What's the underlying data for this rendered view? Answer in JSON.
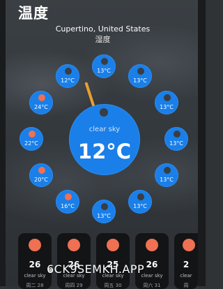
{
  "app": {
    "title": "温度",
    "location": "Cupertino, United States",
    "subtitle": "湿度"
  },
  "current": {
    "condition": "clear sky",
    "temperature": "12°C"
  },
  "hourly": [
    {
      "temp": "13°C",
      "icon": "moon-icon"
    },
    {
      "temp": "13°C",
      "icon": "moon-icon"
    },
    {
      "temp": "13°C",
      "icon": "moon-icon"
    },
    {
      "temp": "13°C",
      "icon": "moon-icon"
    },
    {
      "temp": "13°C",
      "icon": "moon-icon"
    },
    {
      "temp": "13°C",
      "icon": "moon-icon"
    },
    {
      "temp": "13°C",
      "icon": "moon-icon"
    },
    {
      "temp": "13°C",
      "icon": "moon-icon"
    },
    {
      "temp": "16°C",
      "icon": "sun-icon"
    },
    {
      "temp": "20°C",
      "icon": "sun-icon"
    },
    {
      "temp": "22°C",
      "icon": "sun-icon"
    },
    {
      "temp": "24°C",
      "icon": "sun-icon"
    },
    {
      "temp": "12°C",
      "icon": "moon-icon"
    }
  ],
  "daily": [
    {
      "day": "26",
      "desc": "clear sky",
      "date": "周二 28",
      "icon": "sun-icon"
    },
    {
      "day": "26",
      "desc": "clear sky",
      "date": "周四 29",
      "icon": "sun-icon"
    },
    {
      "day": "25",
      "desc": "clear sky",
      "date": "周五 30",
      "icon": "sun-icon"
    },
    {
      "day": "26",
      "desc": "clear sky",
      "date": "周六 31",
      "icon": "sun-icon"
    },
    {
      "day": "2",
      "desc": "clear",
      "date": "周",
      "icon": "sun-icon"
    }
  ],
  "watermark": "6CK9SEMKH.APP",
  "colors": {
    "bubble": "#1a7fe8",
    "sun": "#ef7052",
    "hand": "#e8a030",
    "card": "#121416"
  }
}
